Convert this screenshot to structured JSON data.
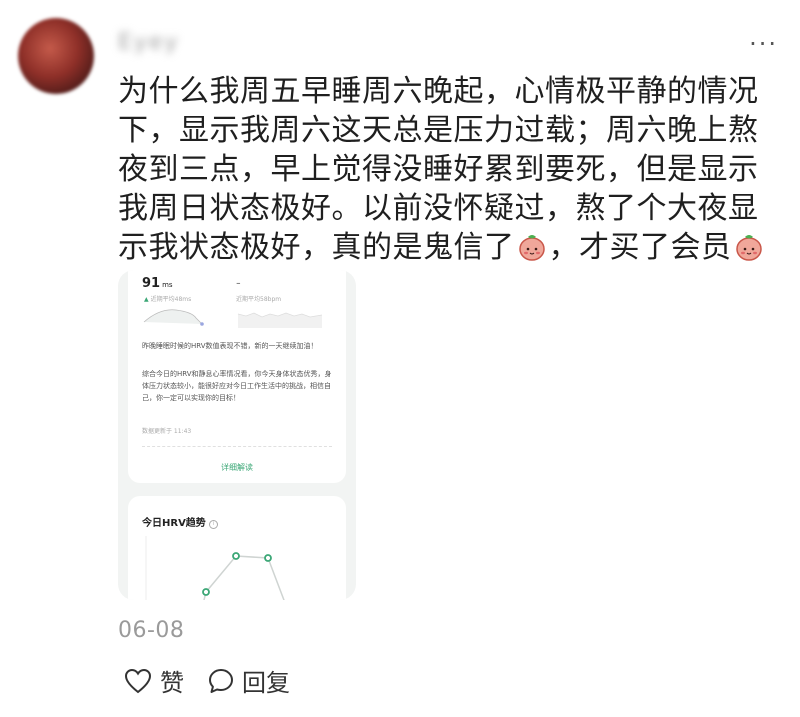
{
  "post": {
    "username": "Eyey",
    "more_icon": "more-dots-icon",
    "text_segments": [
      "为什么我周五早睡周六晚起，心情极平静的情况下，显示我周六这天总是压力过载；周六晚上熬夜到三点，早上觉得没睡好累到要死，但是显示我周日状态极好。以前没怀疑过，熬了个大夜显示我状态极好，真的是鬼信了",
      "，才买了会员"
    ],
    "emoji": "peach-face-emoji",
    "date": "06-08"
  },
  "embedded_screenshot": {
    "metric_value": "91",
    "metric_unit": "ms",
    "metric_value2": "-",
    "avg_label1": "近期平均48ms",
    "avg_label2": "近期平均58bpm",
    "paragraph1": "昨晚睡眠时候的HRV数值表现不错，新的一天继续加油！",
    "paragraph2": "综合今日的HRV和静息心率情况看，你今天身体状态优秀，身体压力状态较小，能很好应对今日工作生活中的挑战，相信自己，你一定可以实现你的目标！",
    "updated": "数据更新于 11:43",
    "detail_link": "详细解读",
    "trend_title": "今日HRV趋势",
    "accent_color": "#3ba776"
  },
  "actions": {
    "like_label": "赞",
    "reply_label": "回复",
    "like_icon": "heart-icon",
    "reply_icon": "speech-bubble-icon"
  }
}
